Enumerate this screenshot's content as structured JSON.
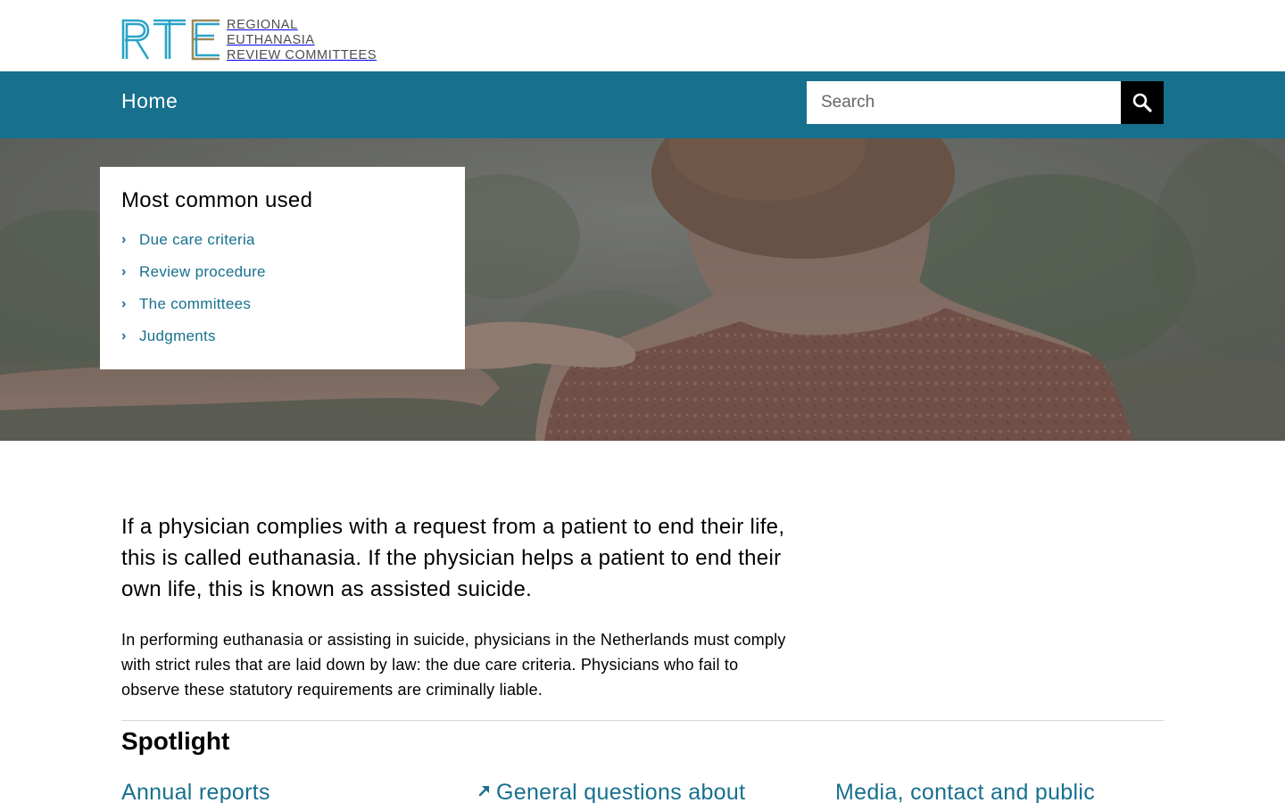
{
  "logo": {
    "mark": "RTE",
    "lines": [
      "REGIONAL",
      "EUTHANASIA",
      "REVIEW COMMITTEES"
    ]
  },
  "nav": {
    "home_label": "Home"
  },
  "search": {
    "placeholder": "Search"
  },
  "popular": {
    "title": "Most common used",
    "items": [
      {
        "label": "Due care criteria"
      },
      {
        "label": "Review procedure"
      },
      {
        "label": "The committees"
      },
      {
        "label": "Judgments"
      }
    ]
  },
  "intro": {
    "lead": "If a physician complies with a request from a patient to end their life, this is called euthanasia. If the physician helps a patient to end their own life, this is known as assisted suicide.",
    "body": "In performing euthanasia or assisting in suicide, physicians in the Netherlands must comply with strict rules that are laid down by law: the due care criteria. Physicians who fail to observe these statutory requirements are criminally liable."
  },
  "spotlight": {
    "title": "Spotlight",
    "cards": [
      {
        "label": "Annual reports"
      },
      {
        "label": "General questions about",
        "icon": "external-arrow-icon"
      },
      {
        "label": "Media, contact and public"
      }
    ]
  },
  "colors": {
    "brand": "#17708e",
    "logo_gold": "#9b8a5a",
    "logo_cyan": "#2aa3c7"
  }
}
